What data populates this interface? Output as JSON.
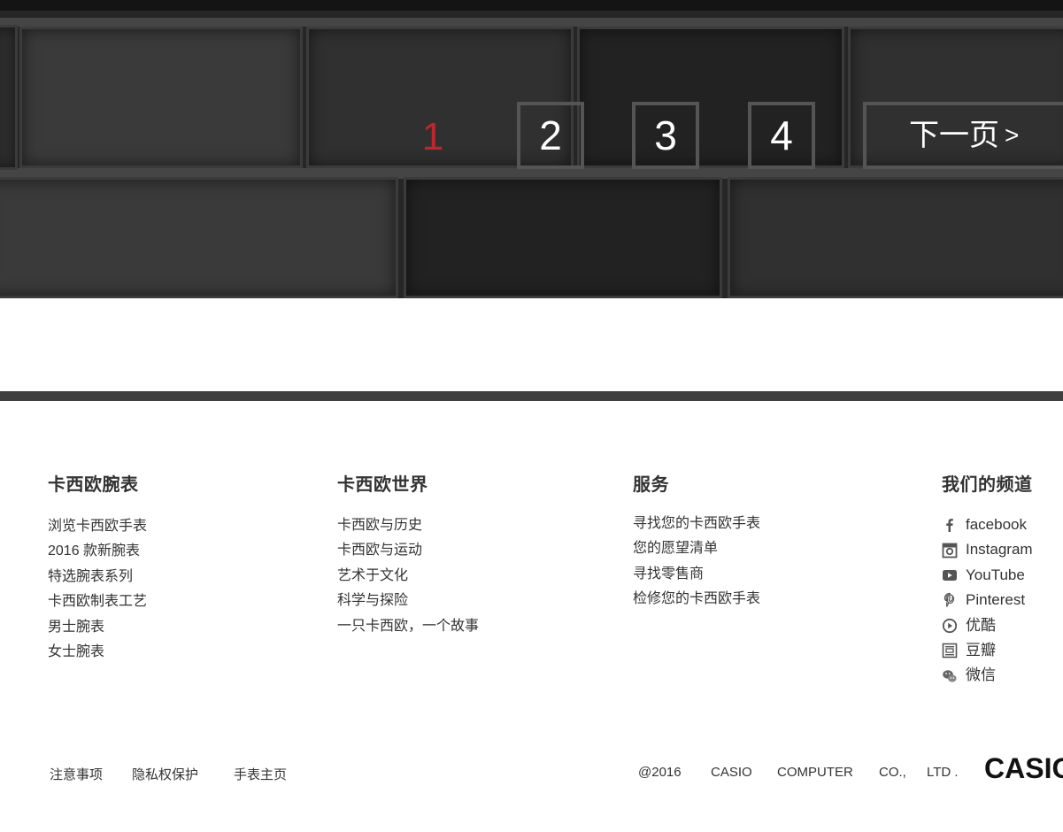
{
  "pagination": {
    "current": "1",
    "pages": [
      "2",
      "3",
      "4"
    ],
    "next_label": "下一页",
    "next_arrow": ">"
  },
  "footer": {
    "columns": [
      {
        "title": "卡西欧腕表",
        "links": [
          "浏览卡西欧手表",
          "2016 款新腕表",
          "特选腕表系列",
          "卡西欧制表工艺",
          "男士腕表",
          "女士腕表"
        ]
      },
      {
        "title": "卡西欧世界",
        "links": [
          "卡西欧与历史",
          "卡西欧与运动",
          "艺术于文化",
          "科学与探险",
          "一只卡西欧，一个故事"
        ]
      },
      {
        "title": "服务",
        "links": [
          "寻找您的卡西欧手表",
          "您的愿望清单",
          "寻找零售商",
          "检修您的卡西欧手表"
        ]
      }
    ],
    "channels": {
      "title": "我们的频道",
      "items": [
        {
          "icon": "facebook-icon",
          "label": "facebook"
        },
        {
          "icon": "instagram-icon",
          "label": "Instagram"
        },
        {
          "icon": "youtube-icon",
          "label": "YouTube"
        },
        {
          "icon": "pinterest-icon",
          "label": "Pinterest"
        },
        {
          "icon": "youku-icon",
          "label": "优酷"
        },
        {
          "icon": "douban-icon",
          "label": "豆瓣"
        },
        {
          "icon": "wechat-icon",
          "label": "微信"
        }
      ]
    }
  },
  "bottom": {
    "links": [
      "注意事项",
      "隐私权保护",
      "手表主页"
    ],
    "copyright": [
      "@2016",
      "CASIO",
      "COMPUTER",
      "CO.,",
      "LTD ."
    ],
    "logo": "CASIO"
  },
  "colors": {
    "active_page": "#c0272d",
    "divider": "#3f3f3f",
    "wall": "#262626"
  }
}
